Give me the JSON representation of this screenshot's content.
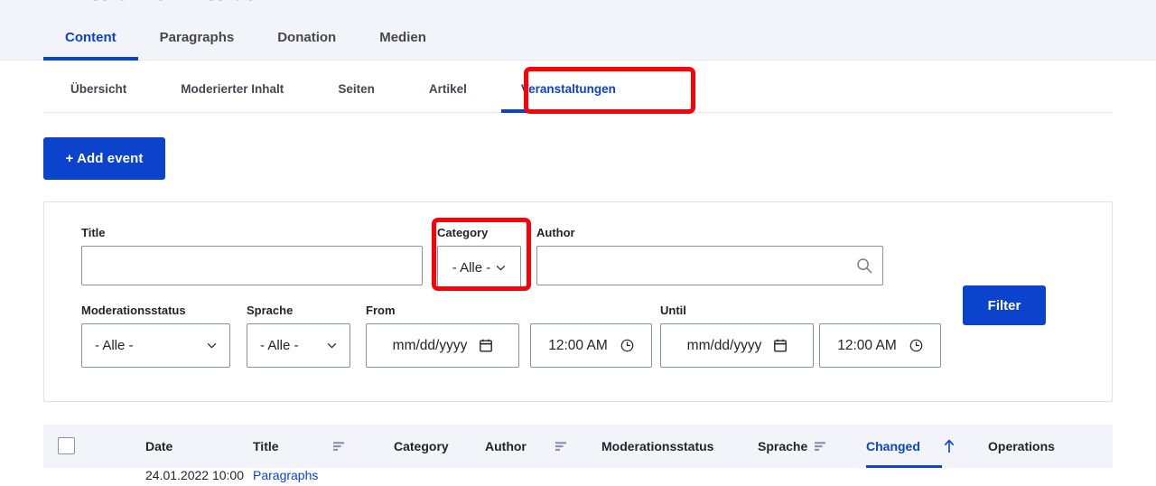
{
  "page": {
    "cut_off_title": "Inhalt verwalten"
  },
  "primary_tabs": [
    {
      "label": "Content",
      "active": true
    },
    {
      "label": "Paragraphs",
      "active": false
    },
    {
      "label": "Donation",
      "active": false
    },
    {
      "label": "Medien",
      "active": false
    }
  ],
  "secondary_tabs": [
    {
      "label": "Übersicht",
      "active": false
    },
    {
      "label": "Moderierter Inhalt",
      "active": false
    },
    {
      "label": "Seiten",
      "active": false
    },
    {
      "label": "Artikel",
      "active": false
    },
    {
      "label": "Veranstaltungen",
      "active": true
    }
  ],
  "actions": {
    "add_event_label": "+ Add event"
  },
  "filters": {
    "title": {
      "label": "Title",
      "value": "",
      "placeholder": ""
    },
    "category": {
      "label": "Category",
      "value": "- Alle -"
    },
    "author": {
      "label": "Author",
      "value": "",
      "placeholder": "",
      "icon": "search-icon"
    },
    "moderationsstatus": {
      "label": "Moderationsstatus",
      "value": "- Alle -"
    },
    "sprache": {
      "label": "Sprache",
      "value": "- Alle -"
    },
    "from": {
      "label": "From",
      "date_value": "mm/dd/yyyy",
      "time_value": "12:00 AM",
      "date_icon": "calendar-icon",
      "time_icon": "clock-icon"
    },
    "until": {
      "label": "Until",
      "date_value": "mm/dd/yyyy",
      "time_value": "12:00 AM",
      "date_icon": "calendar-icon",
      "time_icon": "clock-icon"
    },
    "submit_label": "Filter"
  },
  "table": {
    "columns": [
      {
        "label": "Date",
        "sortable": false,
        "sorted": false
      },
      {
        "label": "Title",
        "sortable": true,
        "sorted": false
      },
      {
        "label": "Category",
        "sortable": false,
        "sorted": false
      },
      {
        "label": "Author",
        "sortable": true,
        "sorted": false
      },
      {
        "label": "Moderationsstatus",
        "sortable": false,
        "sorted": false
      },
      {
        "label": "Sprache",
        "sortable": true,
        "sorted": false
      },
      {
        "label": "Changed",
        "sortable": true,
        "sorted": true,
        "sort_direction": "asc"
      },
      {
        "label": "Operations",
        "sortable": false,
        "sorted": false
      }
    ],
    "rows": [
      {
        "date": "24.01.2022 10:00",
        "title": "Paragraphs"
      }
    ]
  },
  "annotations": [
    {
      "target": "secondary-tab-veranstaltungen",
      "color": "#fb0007"
    },
    {
      "target": "filter-category",
      "color": "#fb0007"
    }
  ],
  "colors": {
    "accent": "#0b43cc",
    "annotation": "#fb0007",
    "header_bg": "#f3f4f9",
    "text": "#232429"
  }
}
